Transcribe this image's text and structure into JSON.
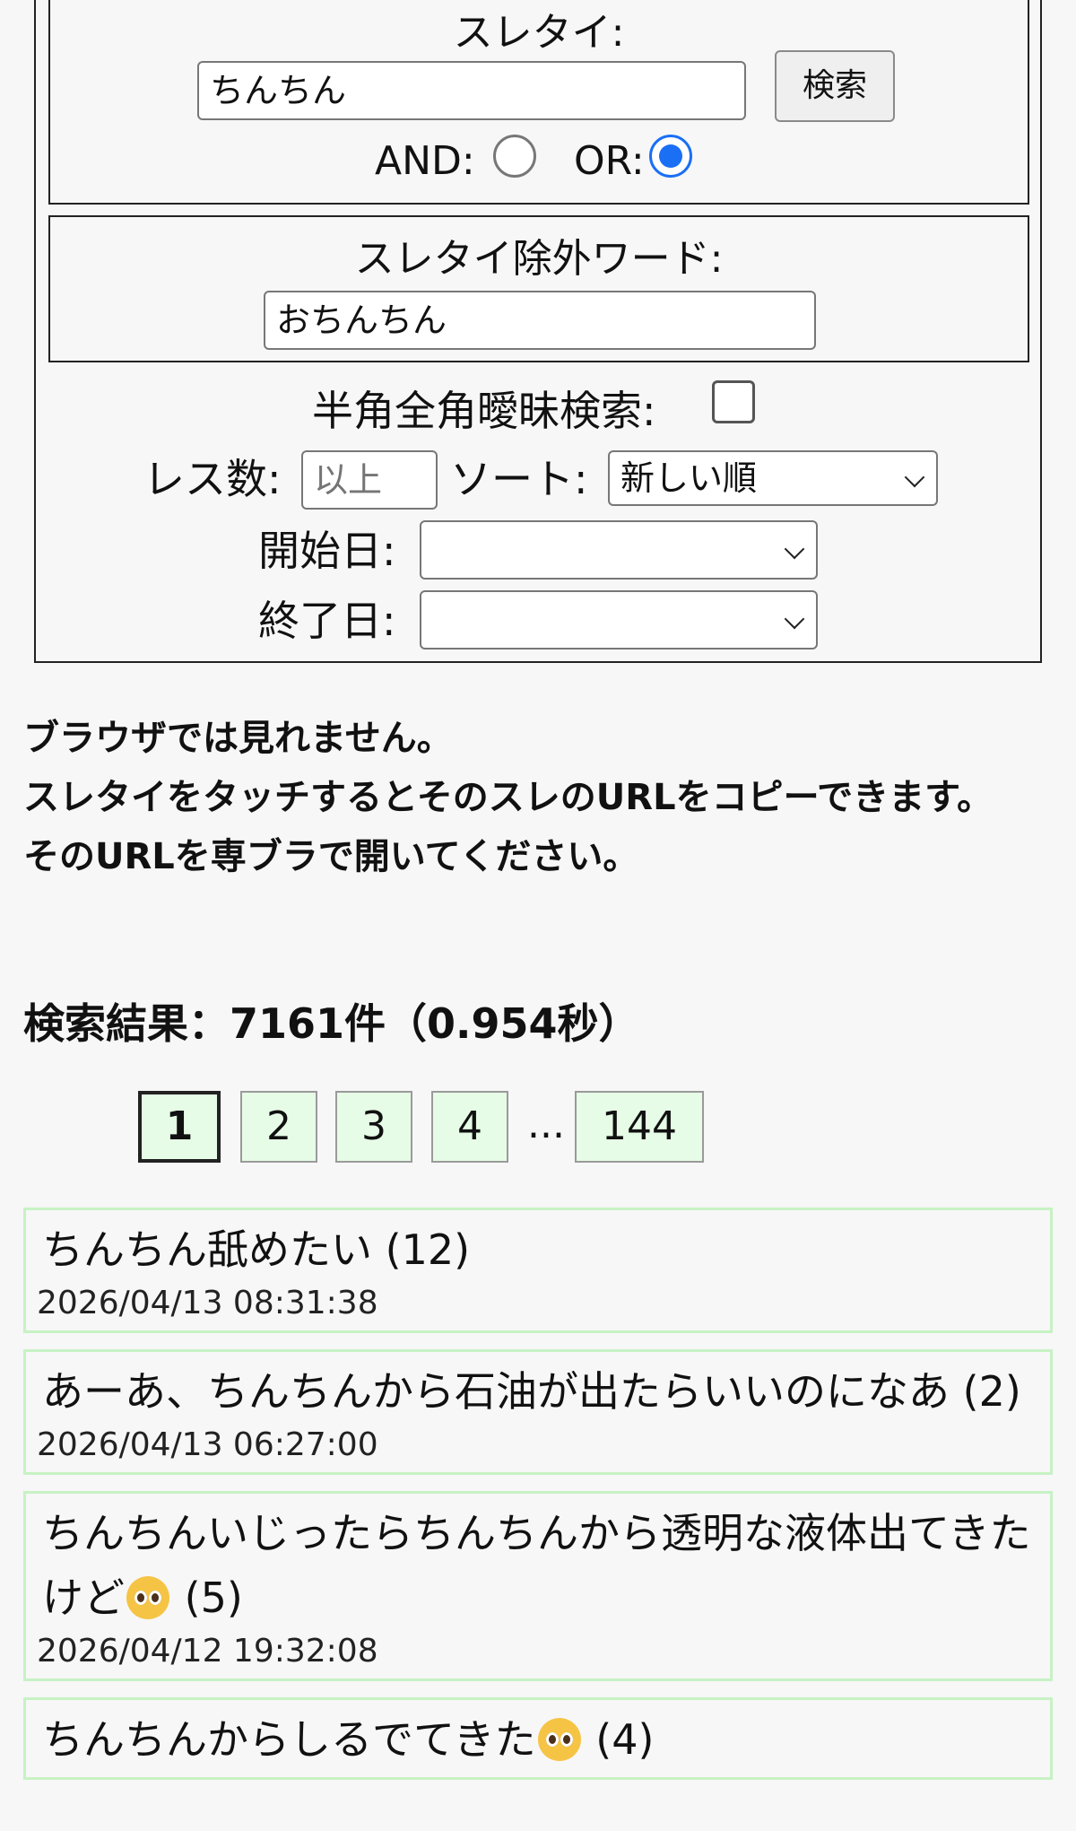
{
  "search_form": {
    "title_label": "スレタイ:",
    "title_value": "ちんちん",
    "search_button": "検索",
    "and_label": "AND:",
    "or_label": "OR:",
    "mode_selected": "OR",
    "exclude_label": "スレタイ除外ワード:",
    "exclude_value": "おちんちん",
    "fuzzy_label": "半角全角曖昧検索:",
    "fuzzy_checked": false,
    "res_count_label": "レス数:",
    "res_count_placeholder": "以上",
    "sort_label": "ソート:",
    "sort_value": "新しい順",
    "start_date_label": "開始日:",
    "start_date_value": "",
    "end_date_label": "終了日:",
    "end_date_value": ""
  },
  "notice": {
    "line1": "ブラウザでは見れません。",
    "line2": "スレタイをタッチするとそのスレのURLをコピーできます。",
    "line3": "そのURLを専ブラで開いてください。"
  },
  "result_count": "検索結果：7161件（0.954秒）",
  "pagination": {
    "pages": [
      "1",
      "2",
      "3",
      "4"
    ],
    "current": "1",
    "ellipsis": "...",
    "last": "144"
  },
  "results": [
    {
      "title": "ちんちん舐めたい (12)",
      "date": "2026/04/13 08:31:38"
    },
    {
      "title": "あーあ、ちんちんから石油が出たらいいのになあ (2)",
      "date": "2026/04/13 06:27:00"
    },
    {
      "title_before": "ちんちんいじったらちんちんから透明な液体出てきたけど",
      "icon": "pleading-face-icon",
      "title_after": " (5)",
      "date": "2026/04/12 19:32:08"
    },
    {
      "title_before": "ちんちんからしるでてきた",
      "icon": "pleading-face-icon",
      "title_after": " (4)",
      "date": ""
    }
  ]
}
